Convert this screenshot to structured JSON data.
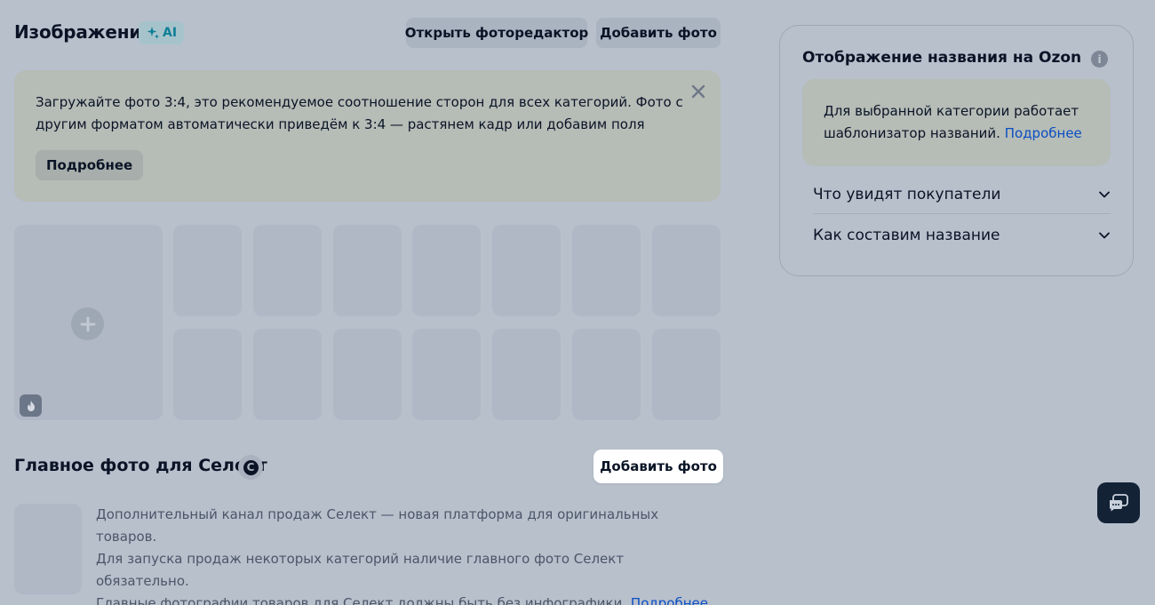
{
  "images": {
    "title": "Изображения",
    "ai_badge": "AI",
    "open_editor_label": "Открыть фоторедактор",
    "add_photo_label": "Добавить фото"
  },
  "banner": {
    "text": "Загружайте фото 3:4, это рекомендуемое соотношение сторон для всех категорий. Фото с другим форматом автоматически приведём к 3:4 — растянем кадр или добавим поля",
    "more_label": "Подробнее"
  },
  "select": {
    "title": "Главное фото для Селект",
    "badge": "C",
    "add_photo_label": "Добавить фото",
    "desc_line1": "Дополнительный канал продаж Селект — новая платформа для оригинальных товаров.",
    "desc_line2": "Для запуска продаж некоторых категорий наличие главного фото Селект обязательно.",
    "desc_line3": "Главные фотографии товаров для Селект должны быть без инфографики.",
    "desc_link": "Подробнее"
  },
  "panel": {
    "title": "Отображение названия на Ozon",
    "note_text": "Для выбранной категории работает шаблонизатор названий.",
    "note_link": "Подробнее",
    "accordion": [
      {
        "label": "Что увидят покупатели"
      },
      {
        "label": "Как составим название"
      }
    ]
  },
  "colors": {
    "background": "#b8c0cc",
    "banner": "#b6bcb6",
    "accent_ai": "#0f7f95",
    "link": "#0b4fc4",
    "chat_fab": "#142236"
  },
  "icons": {
    "ai": "sparkle-icon",
    "close": "close-icon",
    "add": "plus-icon",
    "main_marker": "flame-icon",
    "info": "info-icon",
    "chevron": "chevron-down-icon",
    "chat": "chat-icon"
  }
}
